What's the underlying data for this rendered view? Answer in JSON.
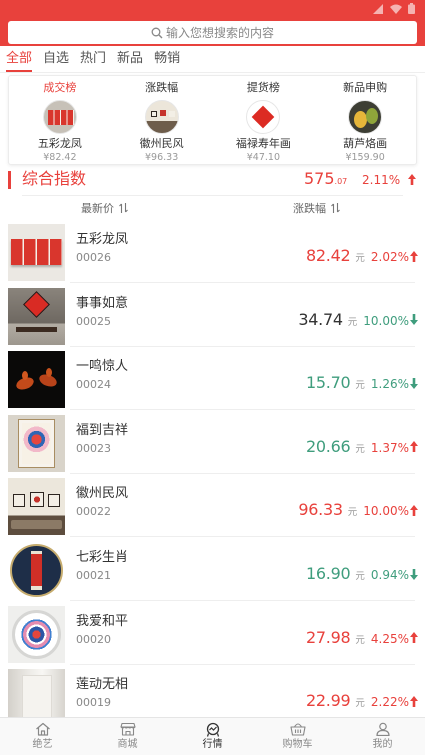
{
  "colors": {
    "accent": "#e8413c",
    "up": "#e8413c",
    "down": "#3f9d7d",
    "neutral": "#333333"
  },
  "search": {
    "placeholder": "输入您想搜索的内容",
    "icon": "search-icon"
  },
  "tabs": [
    {
      "label": "全部",
      "active": true
    },
    {
      "label": "自选",
      "active": false
    },
    {
      "label": "热门",
      "active": false
    },
    {
      "label": "新品",
      "active": false
    },
    {
      "label": "畅销",
      "active": false
    }
  ],
  "rankings": [
    {
      "title": "成交榜",
      "active": true,
      "name": "五彩龙凤",
      "price": "¥82.42"
    },
    {
      "title": "涨跌幅",
      "active": false,
      "name": "徽州民风",
      "price": "¥96.33"
    },
    {
      "title": "提货榜",
      "active": false,
      "name": "福禄寿年画",
      "price": "¥47.10"
    },
    {
      "title": "新品申购",
      "active": false,
      "name": "葫芦烙画",
      "price": "¥159.90"
    }
  ],
  "index": {
    "title": "综合指数",
    "value": "575",
    "value_decimal": ".07",
    "change": "2.11%",
    "arrow_icon": "arrow-up-icon"
  },
  "list_header": {
    "price_label": "最新价",
    "change_label": "涨跌幅",
    "sort_icon": "sort-icon"
  },
  "items": [
    {
      "name": "五彩龙凤",
      "code": "00026",
      "price": "82.42",
      "unit": "元",
      "change": "2.02%",
      "arrow_icon": "arrow-up-icon",
      "price_color": "#e8413c",
      "change_color": "#e8413c"
    },
    {
      "name": "事事如意",
      "code": "00025",
      "price": "34.74",
      "unit": "元",
      "change": "10.00%",
      "arrow_icon": "arrow-down-icon",
      "price_color": "#333333",
      "change_color": "#3f9d7d"
    },
    {
      "name": "一鸣惊人",
      "code": "00024",
      "price": "15.70",
      "unit": "元",
      "change": "1.26%",
      "arrow_icon": "arrow-down-icon",
      "price_color": "#3f9d7d",
      "change_color": "#3f9d7d"
    },
    {
      "name": "福到吉祥",
      "code": "00023",
      "price": "20.66",
      "unit": "元",
      "change": "1.37%",
      "arrow_icon": "arrow-up-icon",
      "price_color": "#3f9d7d",
      "change_color": "#e8413c"
    },
    {
      "name": "徽州民风",
      "code": "00022",
      "price": "96.33",
      "unit": "元",
      "change": "10.00%",
      "arrow_icon": "arrow-up-icon",
      "price_color": "#e8413c",
      "change_color": "#e8413c"
    },
    {
      "name": "七彩生肖",
      "code": "00021",
      "price": "16.90",
      "unit": "元",
      "change": "0.94%",
      "arrow_icon": "arrow-down-icon",
      "price_color": "#3f9d7d",
      "change_color": "#3f9d7d"
    },
    {
      "name": "我爱和平",
      "code": "00020",
      "price": "27.98",
      "unit": "元",
      "change": "4.25%",
      "arrow_icon": "arrow-up-icon",
      "price_color": "#e8413c",
      "change_color": "#e8413c"
    },
    {
      "name": "莲动无相",
      "code": "00019",
      "price": "22.99",
      "unit": "元",
      "change": "2.22%",
      "arrow_icon": "arrow-up-icon",
      "price_color": "#e8413c",
      "change_color": "#e8413c"
    }
  ],
  "nav": [
    {
      "label": "绝艺",
      "icon": "home-icon",
      "active": false
    },
    {
      "label": "商城",
      "icon": "shop-icon",
      "active": false
    },
    {
      "label": "行情",
      "icon": "market-icon",
      "active": true
    },
    {
      "label": "购物车",
      "icon": "cart-icon",
      "active": false
    },
    {
      "label": "我的",
      "icon": "profile-icon",
      "active": false
    }
  ]
}
